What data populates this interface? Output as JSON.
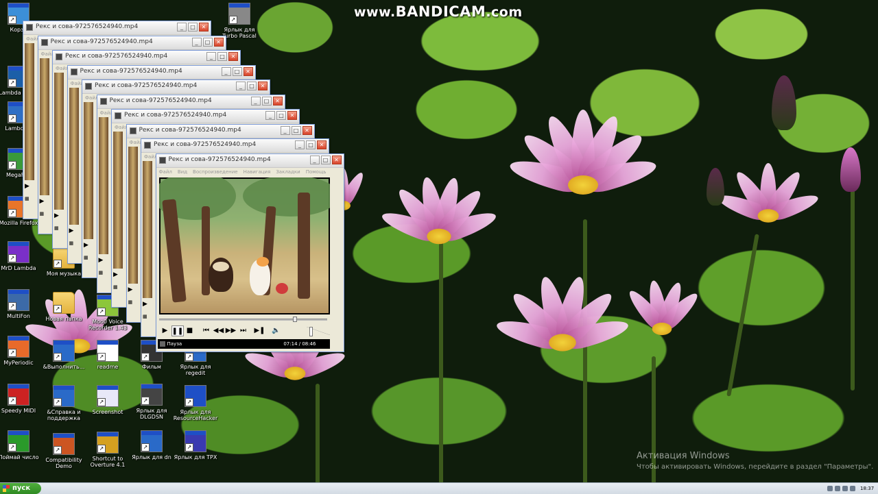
{
  "watermark": {
    "prefix": "www.",
    "brand": "BANDICAM",
    "suffix": ".com"
  },
  "activation": {
    "title": "Активация Windows",
    "text": "Чтобы активировать Windows, перейдите в раздел \"Параметры\"."
  },
  "desktop_icons": [
    {
      "name": "recycle-bin-icon",
      "label": "Корзи",
      "kind": "app"
    },
    {
      "name": "lambda-screen-icon",
      "label": "Lambda Scree",
      "kind": "app"
    },
    {
      "name": "lambda-t-icon",
      "label": "Lambda-T",
      "kind": "app"
    },
    {
      "name": "megafon-icon",
      "label": "MegaFon",
      "kind": "app"
    },
    {
      "name": "firefox-icon",
      "label": "Mozilla Firefox",
      "kind": "app"
    },
    {
      "name": "mrd-lambda-icon",
      "label": "MrD Lambda",
      "kind": "app"
    },
    {
      "name": "multifon-icon",
      "label": "MultiFon",
      "kind": "app"
    },
    {
      "name": "myperiodic-icon",
      "label": "MyPeriodic",
      "kind": "app"
    },
    {
      "name": "speedy-midi-icon",
      "label": "Speedy MIDI",
      "kind": "app"
    },
    {
      "name": "poimai-chislo-icon",
      "label": "Поймай число",
      "kind": "app"
    },
    {
      "name": "moya-muzyka-icon",
      "label": "Моя музыка",
      "kind": "folder"
    },
    {
      "name": "novaya-papka-icon",
      "label": "Новая папка",
      "kind": "folder"
    },
    {
      "name": "vypolnit-icon",
      "label": "&Выполнить...",
      "kind": "app"
    },
    {
      "name": "spravka-icon",
      "label": "&Справка и поддержка",
      "kind": "app"
    },
    {
      "name": "compat-demo-icon",
      "label": "Compatibility Demo",
      "kind": "app"
    },
    {
      "name": "voice-recorder-icon",
      "label": "Moo0 Voice Recorder 1.43",
      "kind": "app"
    },
    {
      "name": "readme-icon",
      "label": "readme",
      "kind": "app"
    },
    {
      "name": "screenshot-icon",
      "label": "Screenshot",
      "kind": "app"
    },
    {
      "name": "overture-icon",
      "label": "Shortcut to Overture 4.1",
      "kind": "app"
    },
    {
      "name": "film-icon",
      "label": "Фильм",
      "kind": "app"
    },
    {
      "name": "dlgdsn-icon",
      "label": "Ярлык для DLGDSN",
      "kind": "app"
    },
    {
      "name": "dn-icon",
      "label": "Ярлык для dn",
      "kind": "app"
    },
    {
      "name": "regedit-icon",
      "label": "Ярлык для regedit",
      "kind": "app"
    },
    {
      "name": "resourcehacker-icon",
      "label": "Ярлык для ResourceHacker",
      "kind": "app"
    },
    {
      "name": "tpx-icon",
      "label": "Ярлык для TPX",
      "kind": "app"
    },
    {
      "name": "turbo-pascal-icon",
      "label": "Ярлык для Turbo Pascal",
      "kind": "app"
    }
  ],
  "window_title": "Рекс и сова-972576524940.mp4",
  "window_count": 10,
  "player": {
    "menu": [
      "Файл",
      "Вид",
      "Воспроизведение",
      "Навигация",
      "Закладки",
      "Помощь"
    ],
    "status": "Пауза",
    "time": "07:14 / 08:46",
    "progress": 0.82,
    "volume": 0.1,
    "controls": [
      "play",
      "pause",
      "stop",
      "prev",
      "rewind",
      "forward",
      "next",
      "step",
      "mute"
    ]
  },
  "taskbar": {
    "start_label": "пуск",
    "clock": "18:37"
  },
  "colors": {
    "accent": "#1e4fc6",
    "start": "#3a9a2c"
  }
}
